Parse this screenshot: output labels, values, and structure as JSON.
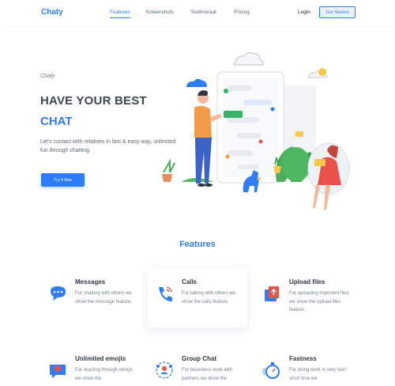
{
  "nav": {
    "logo": "Chaty",
    "links": [
      "Features",
      "Screenshots",
      "Testimonial",
      "Pricing"
    ],
    "login": "Login",
    "cta": "Get Started"
  },
  "hero": {
    "tag": "Chaty",
    "title_line1": "HAVE YOUR BEST",
    "title_line2": "CHAT",
    "description": "Let's contact with relatives in fast & easy way, unlimited fun through chatting.",
    "button": "Try it free"
  },
  "features": {
    "heading": "Features",
    "items": [
      {
        "title": "Messages",
        "desc": "For chatting with others we show the message feature.",
        "icon": "message-bubble-icon"
      },
      {
        "title": "Calls",
        "desc": "For talking with others we show the calls feature.",
        "icon": "phone-icon"
      },
      {
        "title": "Upload files",
        "desc": "For uploading important files we show the upload files feature.",
        "icon": "upload-files-icon"
      },
      {
        "title": "Unlimited emojis",
        "desc": "For reacting through emojis we show the",
        "icon": "heart-chat-icon"
      },
      {
        "title": "Group Chat",
        "desc": "For bussiness work with partners we show the",
        "icon": "group-chat-icon"
      },
      {
        "title": "Fastness",
        "desc": "For doing work in very fast / short time we",
        "icon": "stopwatch-icon"
      }
    ]
  },
  "colors": {
    "accent": "#2e7cf6",
    "heading": "#3d4652",
    "text": "#7a828e"
  }
}
